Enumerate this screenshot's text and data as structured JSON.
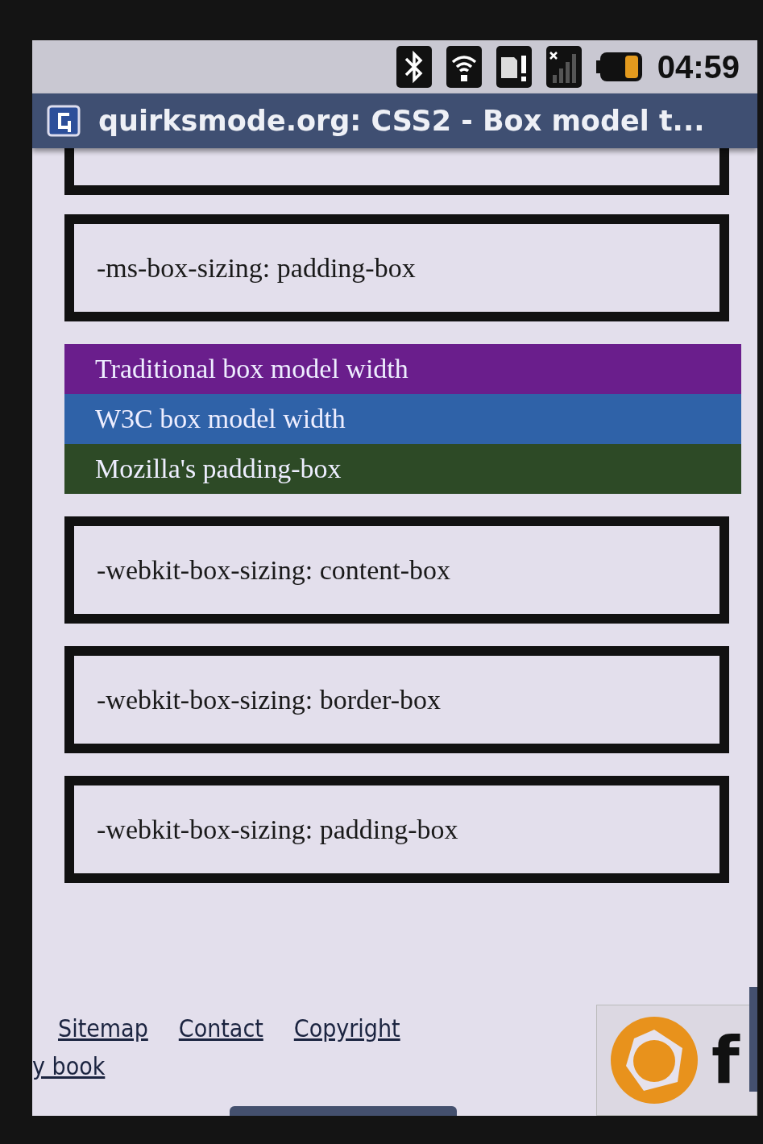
{
  "status_bar": {
    "time": "04:59"
  },
  "title_bar": {
    "title": "quirksmode.org: CSS2 - Box model t..."
  },
  "boxes_top": [
    {
      "label": "-ms-box-sizing: padding-box"
    }
  ],
  "legend": [
    {
      "label": "Traditional box model width",
      "color": "#6a1e8c"
    },
    {
      "label": "W3C box model width",
      "color": "#2f62a8"
    },
    {
      "label": "Mozilla's padding-box",
      "color": "#2d4a26"
    }
  ],
  "boxes_bottom": [
    {
      "label": "-webkit-box-sizing: content-box"
    },
    {
      "label": "-webkit-box-sizing: border-box"
    },
    {
      "label": "-webkit-box-sizing: padding-box"
    }
  ],
  "footer": {
    "links": [
      "Sitemap",
      "Contact",
      "Copyright"
    ],
    "second_line": "y book",
    "logo_text": "f"
  }
}
